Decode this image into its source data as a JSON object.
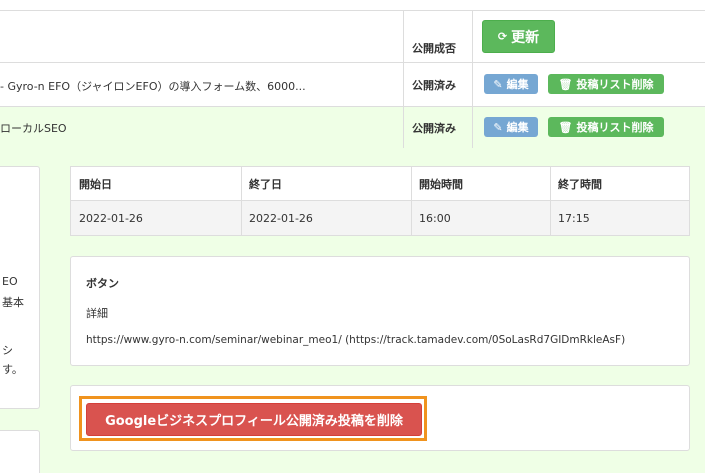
{
  "table": {
    "header_status": "公開成否",
    "update_button": "更新",
    "rows": [
      {
        "title": "- Gyro-n EFO（ジャイロンEFO）の導入フォーム数、6000...",
        "status": "公開済み",
        "edit_label": "編集",
        "delete_label": "投稿リスト削除"
      },
      {
        "title": "ローカルSEO",
        "status": "公開済み",
        "edit_label": "編集",
        "delete_label": "投稿リスト削除"
      }
    ]
  },
  "left_fragments": [
    "EO",
    "基本",
    "シ",
    "す。"
  ],
  "schedule": {
    "headers": [
      "開始日",
      "終了日",
      "開始時間",
      "終了時間"
    ],
    "values": [
      "2022-01-26",
      "2022-01-26",
      "16:00",
      "17:15"
    ]
  },
  "button_section": {
    "title": "ボタン",
    "label": "詳細",
    "url": "https://www.gyro-n.com/seminar/webinar_meo1/ (https://track.tamadev.com/0SoLasRd7GIDmRkleAsF)"
  },
  "delete_gbp_button": "Googleビジネスプロフィール公開済み投稿を削除",
  "icons": {
    "refresh": "refresh-icon",
    "pencil": "pencil-icon",
    "trash": "trash-icon"
  },
  "colors": {
    "success": "#5cb85c",
    "info": "#76a7d3",
    "danger": "#d9534f",
    "highlight": "#f0931e",
    "row_highlight": "#efffe6"
  }
}
